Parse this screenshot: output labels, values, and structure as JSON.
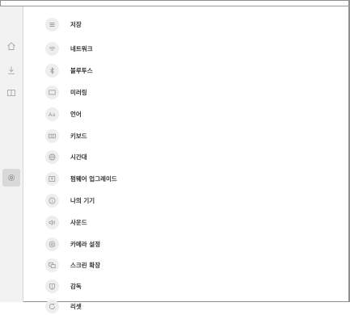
{
  "rail": {
    "items": [
      {
        "icon": "home-icon"
      },
      {
        "icon": "download-icon"
      },
      {
        "icon": "apps-icon"
      },
      {
        "icon": "settings-gear-icon",
        "selected": true
      }
    ]
  },
  "menu": {
    "items": [
      {
        "label": "저장",
        "icon": "storage-icon"
      },
      {
        "label": "네트워크",
        "icon": "wifi-icon"
      },
      {
        "label": "블루투스",
        "icon": "bluetooth-icon"
      },
      {
        "label": "미러링",
        "icon": "mirroring-icon"
      },
      {
        "label": "언어",
        "icon": "language-icon"
      },
      {
        "label": "키보드",
        "icon": "keyboard-icon"
      },
      {
        "label": "시간대",
        "icon": "timezone-globe-icon"
      },
      {
        "label": "펌웨어 업그레이드",
        "icon": "firmware-upgrade-icon"
      },
      {
        "label": "나의 기기",
        "icon": "device-info-icon"
      },
      {
        "label": "사운드",
        "icon": "sound-icon"
      },
      {
        "label": "카메라 설정",
        "icon": "camera-icon"
      },
      {
        "label": "스크린 확장",
        "icon": "screen-extend-icon"
      },
      {
        "label": "감독",
        "icon": "supervision-icon"
      },
      {
        "label": "리셋",
        "icon": "reset-icon"
      }
    ]
  }
}
